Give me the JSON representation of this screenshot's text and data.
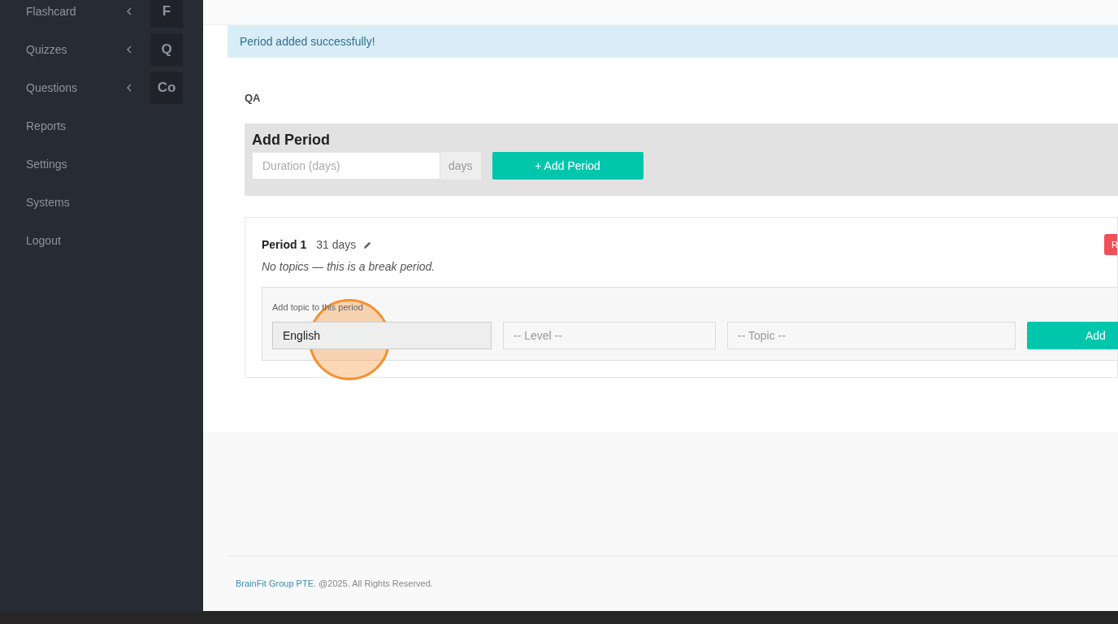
{
  "sidebar": {
    "items": [
      {
        "label": "Flashcard",
        "expandable": true,
        "tile": "F"
      },
      {
        "label": "Quizzes",
        "expandable": true,
        "tile": "Q"
      },
      {
        "label": "Questions",
        "expandable": true,
        "tile": "Co"
      },
      {
        "label": "Reports",
        "expandable": false
      },
      {
        "label": "Settings",
        "expandable": false
      },
      {
        "label": "Systems",
        "expandable": false
      },
      {
        "label": "Logout",
        "expandable": false
      }
    ]
  },
  "alert": "Period added successfully!",
  "section_label": "QA",
  "add_period": {
    "title": "Add Period",
    "placeholder": "Duration (days)",
    "unit": "days",
    "button": "+ Add Period"
  },
  "periods": [
    {
      "name": "Period 1",
      "duration": "31 days",
      "note": "No topics — this is a break period.",
      "remove_button": "R",
      "add_topic": {
        "label": "Add topic to this period",
        "subject": "English",
        "level_placeholder": "-- Level --",
        "topic_placeholder": "-- Topic --",
        "button": "Add"
      }
    }
  ],
  "click_indicator": true,
  "footer": {
    "company": "BrainFit Group PTE",
    "text": ". @2025. All Rights Reserved."
  }
}
